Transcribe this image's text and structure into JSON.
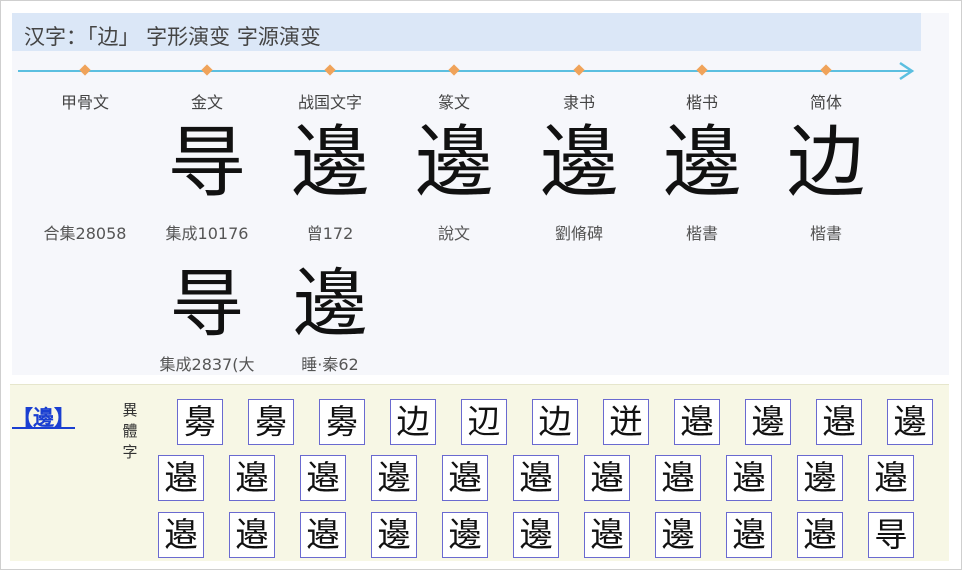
{
  "page_title": "汉字：「边」 字形演变 字源演变",
  "evolution": [
    {
      "era": "甲骨文",
      "glyph": "𠕽",
      "source": "合集28058"
    },
    {
      "era": "金文",
      "glyph": "㝵",
      "source": "集成10176"
    },
    {
      "era": "战国文字",
      "glyph": "邊",
      "source": "曾172"
    },
    {
      "era": "篆文",
      "glyph": "邊",
      "source": "說文"
    },
    {
      "era": "隶书",
      "glyph": "邊",
      "source": "劉脩碑"
    },
    {
      "era": "楷书",
      "glyph": "邊",
      "source": "楷書"
    },
    {
      "era": "简体",
      "glyph": "边",
      "source": "楷書"
    }
  ],
  "evolution_row2": [
    {
      "glyph": "㝵",
      "source": "集成2837(大"
    },
    {
      "glyph": "邊",
      "source": "睡·秦62"
    }
  ],
  "variants_section": {
    "headword": "【邊】",
    "label": "異體字",
    "rows": [
      [
        "臱",
        "臱",
        "臱",
        "边",
        "辺",
        "边",
        "迸",
        "邉",
        "邊",
        "邉",
        "邊"
      ],
      [
        "邉",
        "邉",
        "邉",
        "邊",
        "邉",
        "邉",
        "邉",
        "邉",
        "邉",
        "邊",
        "邉"
      ],
      [
        "邉",
        "邉",
        "邉",
        "邊",
        "邊",
        "邊",
        "邉",
        "邊",
        "邉",
        "邉",
        "㝵"
      ]
    ]
  },
  "colors": {
    "title_bar": "#dbe7f7",
    "timeline": "#5bbfe0",
    "dot": "#f0a35a",
    "link": "#1a3fd1",
    "box_border": "#6a6ad0",
    "variants_bg": "#f7f7e5"
  }
}
